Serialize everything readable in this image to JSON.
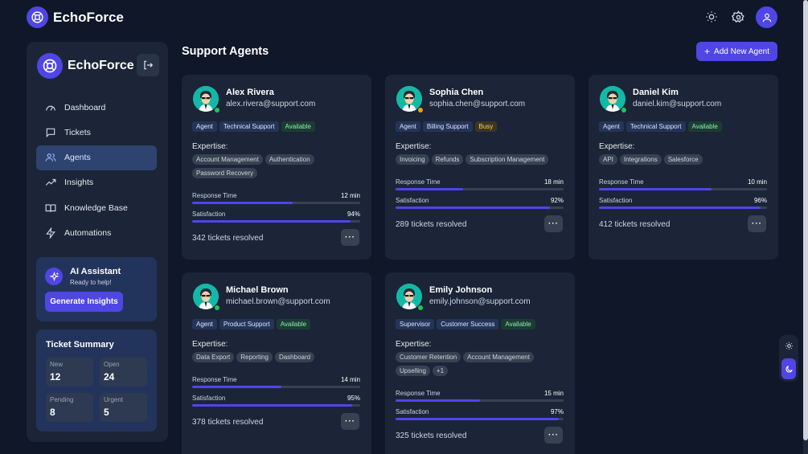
{
  "app": {
    "name": "EchoForce"
  },
  "topbar": {
    "brand": "EchoForce",
    "icons": [
      "sun-icon",
      "gear-icon",
      "user-icon"
    ]
  },
  "sidebar": {
    "brand": "EchoForce",
    "nav": [
      {
        "label": "Dashboard",
        "icon": "gauge-icon",
        "active": false
      },
      {
        "label": "Tickets",
        "icon": "message-icon",
        "active": false
      },
      {
        "label": "Agents",
        "icon": "users-icon",
        "active": true
      },
      {
        "label": "Insights",
        "icon": "trending-up-icon",
        "active": false
      },
      {
        "label": "Knowledge Base",
        "icon": "book-icon",
        "active": false
      },
      {
        "label": "Automations",
        "icon": "lightning-icon",
        "active": false
      }
    ],
    "ai_assistant": {
      "title": "AI Assistant",
      "subtitle": "Ready to help!",
      "button": "Generate Insights"
    },
    "ticket_summary": {
      "title": "Ticket Summary",
      "items": [
        {
          "label": "New",
          "value": "12"
        },
        {
          "label": "Open",
          "value": "24"
        },
        {
          "label": "Pending",
          "value": "8"
        },
        {
          "label": "Urgent",
          "value": "5"
        }
      ]
    }
  },
  "main": {
    "title": "Support Agents",
    "add_button": "Add New Agent",
    "expertise_label": "Expertise:",
    "response_label": "Response Time",
    "satisfaction_label": "Satisfaction",
    "agents": [
      {
        "name": "Alex Rivera",
        "email": "alex.rivera@support.com",
        "role": "Agent",
        "team": "Technical Support",
        "status": "Available",
        "status_color": "#22c55e",
        "expertise": [
          "Account Management",
          "Authentication",
          "Password Recovery"
        ],
        "response_time": "12 min",
        "response_fraction": 0.6,
        "satisfaction": "94%",
        "satisfaction_fraction": 0.94,
        "resolved": "342 tickets resolved"
      },
      {
        "name": "Sophia Chen",
        "email": "sophia.chen@support.com",
        "role": "Agent",
        "team": "Billing Support",
        "status": "Busy",
        "status_color": "#f59e0b",
        "expertise": [
          "Invoicing",
          "Refunds",
          "Subscription Management"
        ],
        "response_time": "18 min",
        "response_fraction": 0.4,
        "satisfaction": "92%",
        "satisfaction_fraction": 0.92,
        "resolved": "289 tickets resolved"
      },
      {
        "name": "Daniel Kim",
        "email": "daniel.kim@support.com",
        "role": "Agent",
        "team": "Technical Support",
        "status": "Available",
        "status_color": "#22c55e",
        "expertise": [
          "API",
          "Integrations",
          "Salesforce"
        ],
        "response_time": "10 min",
        "response_fraction": 0.67,
        "satisfaction": "96%",
        "satisfaction_fraction": 0.96,
        "resolved": "412 tickets resolved"
      },
      {
        "name": "Michael Brown",
        "email": "michael.brown@support.com",
        "role": "Agent",
        "team": "Product Support",
        "status": "Available",
        "status_color": "#22c55e",
        "expertise": [
          "Data Export",
          "Reporting",
          "Dashboard"
        ],
        "response_time": "14 min",
        "response_fraction": 0.53,
        "satisfaction": "95%",
        "satisfaction_fraction": 0.95,
        "resolved": "378 tickets resolved"
      },
      {
        "name": "Emily Johnson",
        "email": "emily.johnson@support.com",
        "role": "Supervisor",
        "team": "Customer Success",
        "status": "Available",
        "status_color": "#22c55e",
        "expertise": [
          "Customer Retention",
          "Account Management",
          "Upselling",
          "+1"
        ],
        "response_time": "15 min",
        "response_fraction": 0.5,
        "satisfaction": "97%",
        "satisfaction_fraction": 0.97,
        "resolved": "325 tickets resolved"
      }
    ]
  },
  "colors": {
    "accent": "#4f46e5",
    "background": "#0f1729",
    "card": "#1b2537",
    "available": "#22c55e",
    "busy": "#f59e0b"
  }
}
